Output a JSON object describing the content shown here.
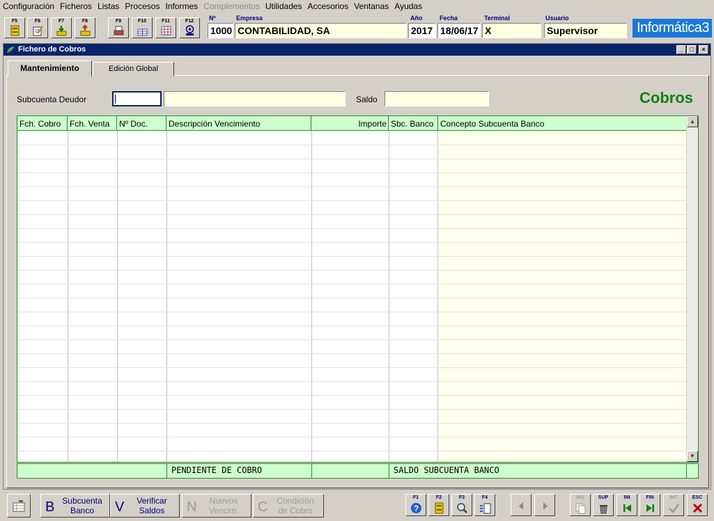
{
  "menu": [
    "Configuración",
    "Ficheros",
    "Listas",
    "Procesos",
    "Informes",
    "Complementos",
    "Utilidades",
    "Accesorios",
    "Ventanas",
    "Ayudas"
  ],
  "menu_disabled": [
    "Complementos"
  ],
  "toolbar": {
    "keys": [
      "F5",
      "F6",
      "F7",
      "F8",
      "F9",
      "F10",
      "F11",
      "F12"
    ],
    "icons": [
      "archive-icon",
      "edit-document-icon",
      "import-arrow-icon",
      "export-arrow-icon",
      "print-icon",
      "debit-credit-icon",
      "calculator-grid-icon",
      "email-fax-icon"
    ]
  },
  "header": {
    "labels": {
      "numero": "Nº",
      "empresa": "Empresa",
      "anio": "Año",
      "fecha": "Fecha",
      "terminal": "Terminal",
      "usuario": "Usuario"
    },
    "values": {
      "numero": "1000",
      "empresa": "CONTABILIDAD, SA",
      "anio": "2017",
      "fecha": "18/06/17",
      "terminal": "X",
      "usuario": "Supervisor"
    },
    "logo": "Informática3"
  },
  "window": {
    "title": "Fichero de Cobros"
  },
  "tabs": [
    "Mantenimiento",
    "Edición Global"
  ],
  "form": {
    "subcuenta_label": "Subcuenta Deudor",
    "saldo_label": "Saldo",
    "subcuenta_value": "",
    "subcuenta_desc": "",
    "saldo_value": "",
    "section_title": "Cobros"
  },
  "grid": {
    "columns": [
      "Fch. Cobro",
      "Fch. Venta",
      "Nº Doc.",
      "Descripción Vencimiento",
      "Importe",
      "Sbc. Banco",
      "Concepto Subcuenta Banco"
    ],
    "rows": []
  },
  "footer": {
    "pendiente": "PENDIENTE DE COBRO",
    "saldo_banco": "SALDO SUBCUENTA BANCO"
  },
  "bottom_buttons": [
    {
      "letter": "B",
      "label1": "Subcuenta",
      "label2": "Banco",
      "enabled": true
    },
    {
      "letter": "V",
      "label1": "Verificar",
      "label2": "Saldos",
      "enabled": true
    },
    {
      "letter": "N",
      "label1": "Nuevos",
      "label2": "Vencim.",
      "enabled": false
    },
    {
      "letter": "C",
      "label1": "Condición",
      "label2": "de Cobro",
      "enabled": false
    }
  ],
  "fkeys_right": [
    "F1",
    "F2",
    "F3",
    "F4"
  ],
  "nav_keys": [
    "INS",
    "SUP",
    "INI",
    "FIN",
    "INT",
    "ESC"
  ],
  "colors": {
    "accent_green": "#108010",
    "title_blue": "#0a246a",
    "grid_header": "#ccffcc",
    "grid_border": "#2e8b2e",
    "yellow_field": "#ffffe1"
  }
}
